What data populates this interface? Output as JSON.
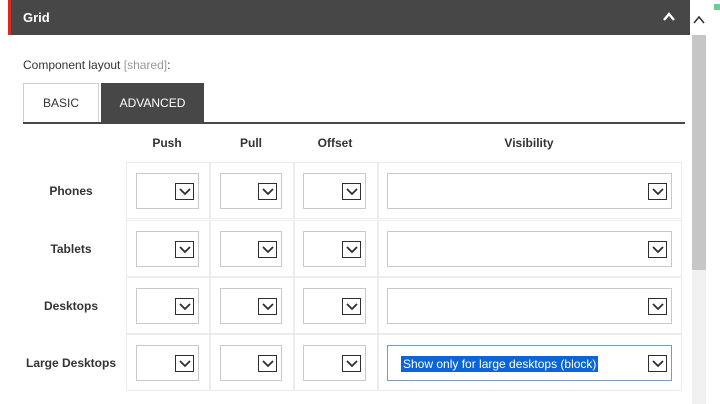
{
  "panel": {
    "title": "Grid"
  },
  "layout": {
    "label": "Component layout ",
    "shared": "[shared]",
    "suffix": ":"
  },
  "tabs": [
    {
      "label": "BASIC",
      "active": false
    },
    {
      "label": "ADVANCED",
      "active": true
    }
  ],
  "columns": [
    "Push",
    "Pull",
    "Offset",
    "Visibility"
  ],
  "rows": [
    {
      "label": "Phones",
      "push": "",
      "pull": "",
      "offset": "",
      "visibility": ""
    },
    {
      "label": "Tablets",
      "push": "",
      "pull": "",
      "offset": "",
      "visibility": ""
    },
    {
      "label": "Desktops",
      "push": "",
      "pull": "",
      "offset": "",
      "visibility": ""
    },
    {
      "label": "Large Desktops",
      "push": "",
      "pull": "",
      "offset": "",
      "visibility": "Show only for large desktops (block)"
    }
  ],
  "colors": {
    "header": "#474747",
    "accent": "#dc291e",
    "selection": "#0b64d8"
  },
  "icons": {
    "collapse": "chevron-up-icon",
    "dropdown": "chevron-down-icon"
  }
}
